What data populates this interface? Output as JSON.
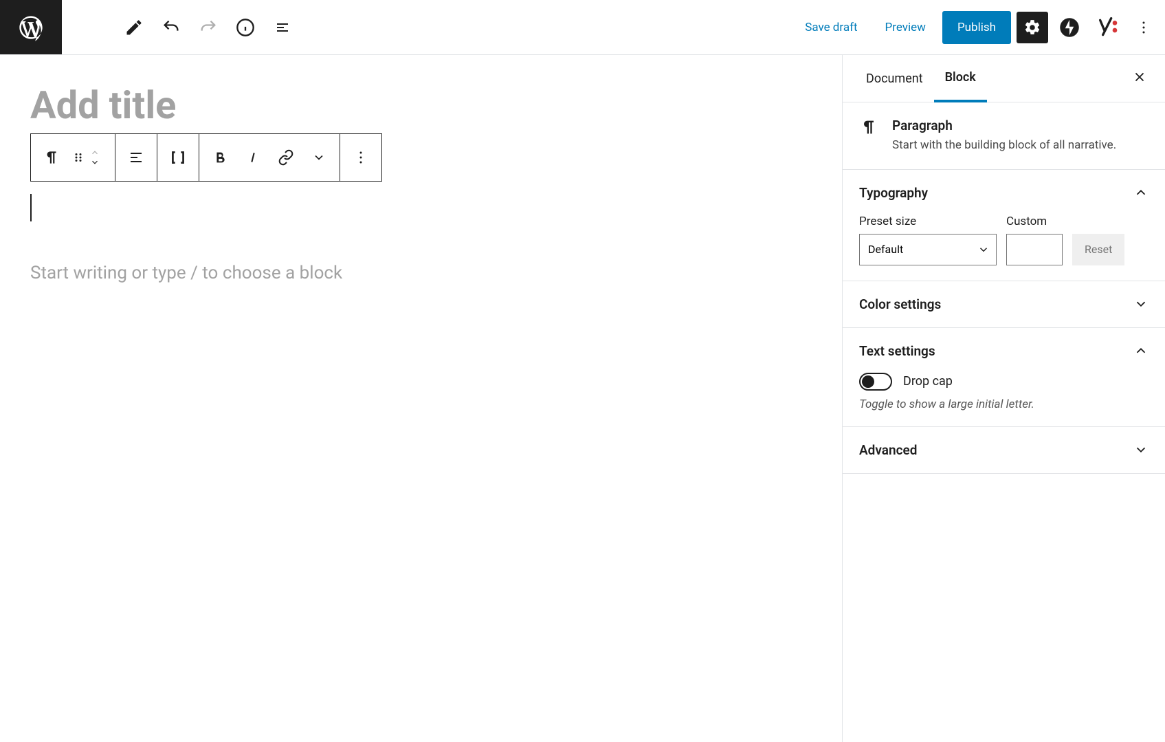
{
  "header": {
    "save_draft": "Save draft",
    "preview": "Preview",
    "publish": "Publish"
  },
  "editor": {
    "title_placeholder": "Add title",
    "block_prompt": "Start writing or type / to choose a block"
  },
  "sidebar": {
    "tabs": {
      "document": "Document",
      "block": "Block"
    },
    "block_info": {
      "title": "Paragraph",
      "desc": "Start with the building block of all narrative."
    },
    "typography": {
      "heading": "Typography",
      "preset_label": "Preset size",
      "custom_label": "Custom",
      "preset_value": "Default",
      "reset": "Reset"
    },
    "color": {
      "heading": "Color settings"
    },
    "text": {
      "heading": "Text settings",
      "dropcap": "Drop cap",
      "hint": "Toggle to show a large initial letter."
    },
    "advanced": {
      "heading": "Advanced"
    }
  }
}
